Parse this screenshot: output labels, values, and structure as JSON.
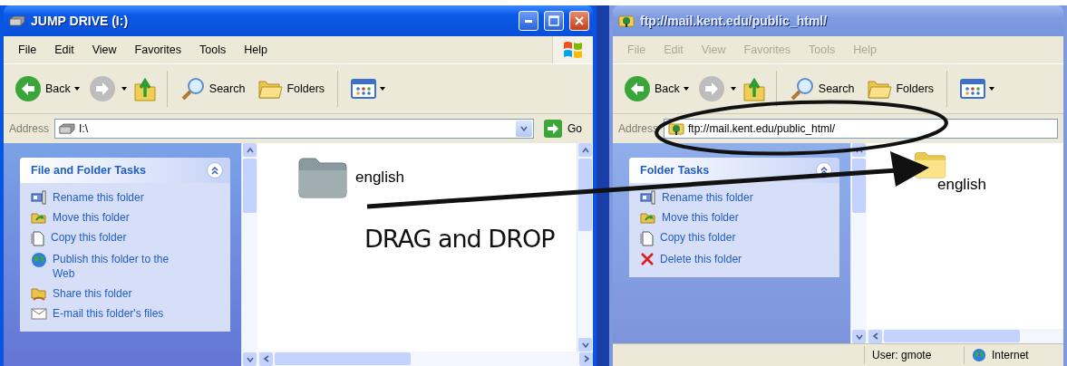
{
  "windows": [
    {
      "active": true,
      "title": "JUMP DRIVE (I:)",
      "menu": [
        "File",
        "Edit",
        "View",
        "Favorites",
        "Tools",
        "Help"
      ],
      "toolbar": {
        "back": "Back",
        "search": "Search",
        "folders": "Folders"
      },
      "address": {
        "label": "Address",
        "value": "I:\\",
        "go": "Go"
      },
      "task_panel": {
        "title": "File and Folder Tasks",
        "expanded": true,
        "tasks": [
          {
            "kind": "rename",
            "label": "Rename this folder"
          },
          {
            "kind": "move",
            "label": "Move this folder"
          },
          {
            "kind": "copy",
            "label": "Copy this folder"
          },
          {
            "kind": "publish",
            "label": "Publish this folder to the Web"
          },
          {
            "kind": "share",
            "label": "Share this folder"
          },
          {
            "kind": "email",
            "label": "E-mail this folder's files"
          }
        ]
      },
      "items": [
        {
          "name": "english",
          "ghosted": true
        }
      ]
    },
    {
      "active": false,
      "title": "ftp://mail.kent.edu/public_html/",
      "menu": [
        "File",
        "Edit",
        "View",
        "Favorites",
        "Tools",
        "Help"
      ],
      "toolbar": {
        "back": "Back",
        "search": "Search",
        "folders": "Folders"
      },
      "address": {
        "label": "Address",
        "value": "ftp://mail.kent.edu/public_html/"
      },
      "task_panel": {
        "title": "Folder Tasks",
        "expanded": true,
        "tasks": [
          {
            "kind": "rename",
            "label": "Rename this folder"
          },
          {
            "kind": "move",
            "label": "Move this folder"
          },
          {
            "kind": "copy",
            "label": "Copy this folder"
          },
          {
            "kind": "delete",
            "label": "Delete this folder"
          }
        ]
      },
      "items": [
        {
          "name": "english",
          "ghosted": false
        }
      ],
      "status_bar": {
        "user": "User: gmote",
        "zone": "Internet"
      }
    }
  ],
  "annotation": {
    "label": "DRAG and DROP"
  }
}
